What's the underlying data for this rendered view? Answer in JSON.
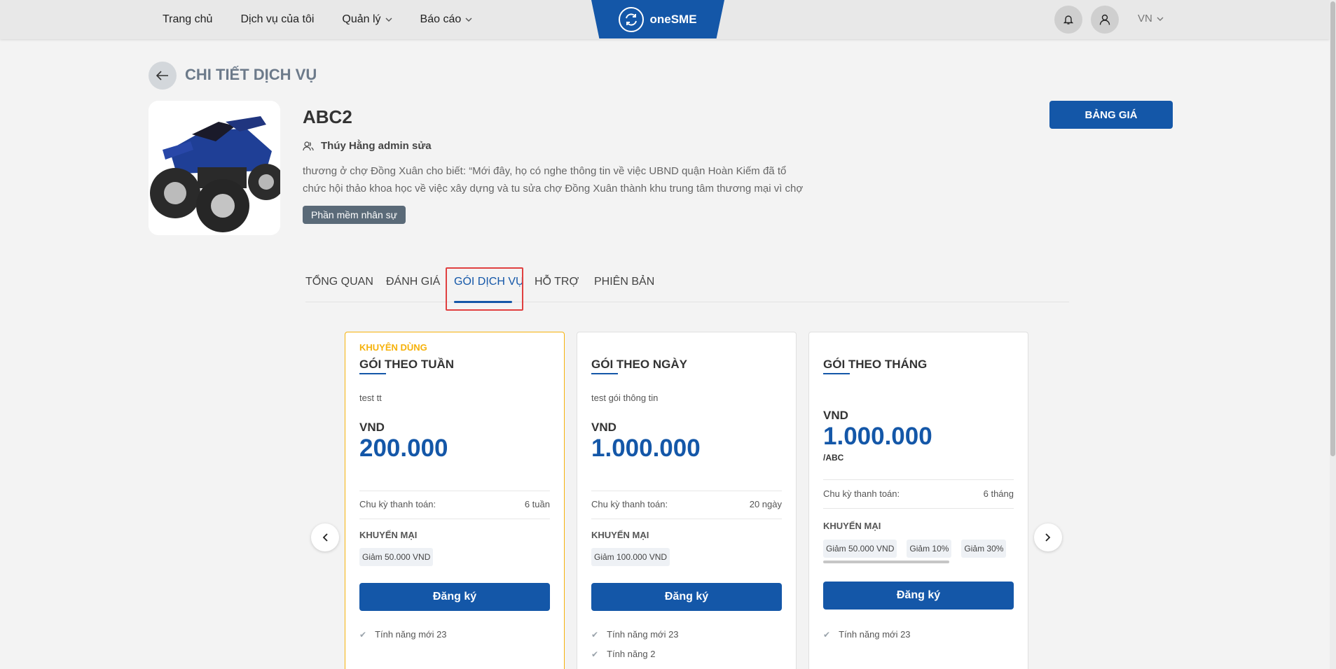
{
  "header": {
    "nav": [
      {
        "label": "Trang chủ",
        "dropdown": false
      },
      {
        "label": "Dịch vụ của tôi",
        "dropdown": false
      },
      {
        "label": "Quản lý",
        "dropdown": true
      },
      {
        "label": "Báo cáo",
        "dropdown": true
      }
    ],
    "logo": "oneSME",
    "lang": "VN",
    "icons": [
      "bell-icon",
      "user-icon"
    ]
  },
  "page": {
    "title": "CHI TIẾT DỊCH VỤ"
  },
  "product": {
    "name": "ABC2",
    "owner": "Thúy Hằng admin sửa",
    "description": "thương ở chợ Đồng Xuân cho biết: “Mới đây, họ có nghe thông tin về việc UBND quận Hoàn Kiếm đã tổ chức hội thảo khoa học về việc xây dựng và tu sửa chợ Đồng Xuân thành khu trung tâm thương mại vì chợ",
    "category": "Phần mềm nhân sự",
    "price_button": "BẢNG GIÁ"
  },
  "tabs": [
    {
      "label": "TỔNG QUAN",
      "active": false
    },
    {
      "label": "ĐÁNH GIÁ",
      "active": false
    },
    {
      "label": "GÓI DỊCH VỤ",
      "active": true
    },
    {
      "label": "HỖ TRỢ",
      "active": false
    },
    {
      "label": "PHIÊN BẢN",
      "active": false
    }
  ],
  "plans": [
    {
      "badge": "KHUYÊN DÙNG",
      "name": "GÓI THEO TUẦN",
      "description": "test tt",
      "currency": "VND",
      "price": "200.000",
      "cycle_label": "Chu kỳ thanh toán:",
      "cycle_value": "6 tuần",
      "promo_title": "KHUYẾN MẠI",
      "promos": [
        "Giảm  50.000 VND"
      ],
      "register": "Đăng ký",
      "features": [
        "Tính năng mới 23"
      ]
    },
    {
      "name": "GÓI THEO NGÀY",
      "description": "test gói thông tin",
      "currency": "VND",
      "price": "1.000.000",
      "cycle_label": "Chu kỳ thanh toán:",
      "cycle_value": "20 ngày",
      "promo_title": "KHUYẾN MẠI",
      "promos": [
        "Giảm  100.000 VND"
      ],
      "register": "Đăng ký",
      "features": [
        "Tính năng mới 23",
        "Tính năng 2"
      ]
    },
    {
      "name": "GÓI THEO THÁNG",
      "currency": "VND",
      "price": "1.000.000",
      "unit": "/ABC",
      "cycle_label": "Chu kỳ thanh toán:",
      "cycle_value": "6 tháng",
      "promo_title": "KHUYẾN MẠI",
      "promos": [
        "Giảm  50.000 VND",
        "Giảm  10%",
        "Giảm  30%"
      ],
      "register": "Đăng ký",
      "features": [
        "Tính năng mới 23"
      ]
    }
  ],
  "colors": {
    "primary": "#1457a8",
    "recommended": "#f6b20b",
    "highlight": "#e04040"
  }
}
